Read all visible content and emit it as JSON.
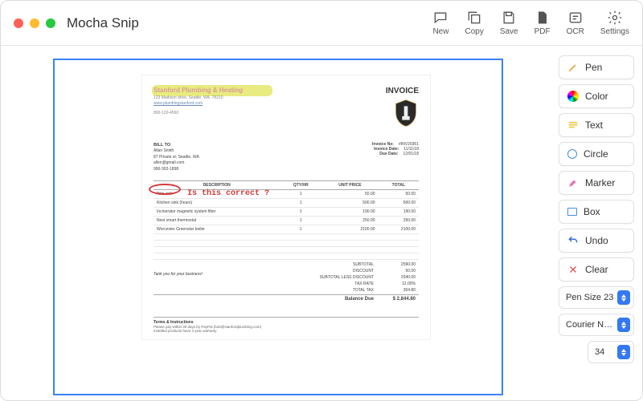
{
  "app": {
    "title": "Mocha Snip"
  },
  "toolbar": {
    "new": "New",
    "copy": "Copy",
    "save": "Save",
    "pdf": "PDF",
    "ocr": "OCR",
    "settings": "Settings"
  },
  "tools": {
    "pen": "Pen",
    "color": "Color",
    "text": "Text",
    "circle": "Circle",
    "marker": "Marker",
    "box": "Box",
    "undo": "Undo",
    "clear": "Clear"
  },
  "controls": {
    "pen_size_label": "Pen Size 23",
    "font_label": "Courier N…",
    "font_size": "34"
  },
  "annotations": {
    "note_text": "Is this correct ?"
  },
  "invoice": {
    "company": {
      "name": "Stanford Plumbing & Heating",
      "address": "123 Madison drive, Seattle, WA, 78210",
      "website": "www.plumbingstanford.com",
      "phone": "890-120-4560"
    },
    "title": "INVOICE",
    "meta": {
      "invoice_no_k": "Invoice No:",
      "invoice_no_v": "#INV20361",
      "invoice_date_k": "Invoice Date:",
      "invoice_date_v": "11/11/18",
      "due_date_k": "Due Date:",
      "due_date_v": "12/01/18"
    },
    "bill_to": {
      "label": "BILL TO",
      "name": "Allan Smith",
      "address": "87 Private st, Seattle, WA",
      "email": "allen@gmail.com",
      "phone": "990-302-1898"
    },
    "columns": {
      "desc": "DESCRIPTION",
      "qty": "QTY/HR",
      "unit": "UNIT PRICE",
      "total": "TOTAL"
    },
    "rows": [
      {
        "desc": "Toto sink",
        "qty": "1",
        "unit": "50.00",
        "total": "50.00"
      },
      {
        "desc": "Kitchen sink (hours)",
        "qty": "1",
        "unit": "500.00",
        "total": "500.00"
      },
      {
        "desc": "Incinerator magnetic system filter",
        "qty": "1",
        "unit": "190.00",
        "total": "190.00"
      },
      {
        "desc": "Nest smart thermostat",
        "qty": "1",
        "unit": "250.00",
        "total": "250.00"
      },
      {
        "desc": "Worcester Greenstar boiler",
        "qty": "1",
        "unit": "2100.00",
        "total": "2100.00"
      }
    ],
    "totals": {
      "subtotal_k": "SUBTOTAL",
      "subtotal_v": "2590.00",
      "discount_k": "DISCOUNT",
      "discount_v": "50.00",
      "sub_less_k": "SUBTOTAL LESS DISCOUNT",
      "sub_less_v": "2540.00",
      "tax_rate_k": "TAX RATE",
      "tax_rate_v": "12.00%",
      "total_tax_k": "TOTAL TAX",
      "total_tax_v": "304.80",
      "balance_k": "Balance Due",
      "balance_v": "$ 2,844.80"
    },
    "thanks": "Tank you for your business!",
    "terms": {
      "heading": "Terms & Instructions",
      "line1": "Please pay within 30 days by PayPal (bob@stanfordplumbing.com)",
      "line2": "Installed products have 3 year warranty"
    }
  }
}
